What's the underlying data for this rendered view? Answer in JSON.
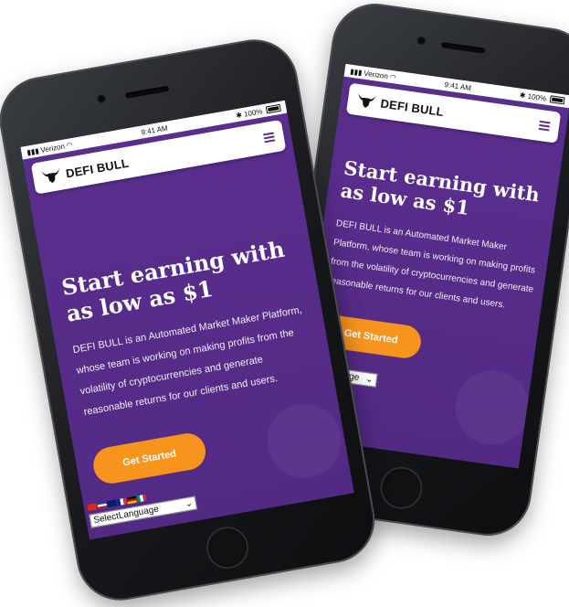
{
  "phones": {
    "left": {
      "status": {
        "carrier": "Verizon",
        "time": "9:41 AM",
        "battery": "100%"
      },
      "brand": "DEFI BULL",
      "hero": {
        "title": "Start earning with as low as $1",
        "text": "DEFI BULL is an Automated Market Maker Platform, whose team is working on making profits from the volatility of cryptocurrencies and generate reasonable returns for our clients and users."
      },
      "cta": "Get Started",
      "language_select": "SelectLanguage"
    },
    "right": {
      "status": {
        "carrier": "Verizon",
        "time": "9:41 AM",
        "battery": "100%"
      },
      "brand": "DEFI BULL",
      "hero": {
        "title": "Start earning with as low as $1",
        "text": "DEFI BULL is an Automated Market Maker Platform, whose team is working on making profits from the volatility of cryptocurrencies and generate reasonable returns for our clients and users."
      },
      "cta": "Get Started",
      "language_select": "Language"
    }
  },
  "icons": [
    "bull-logo-icon",
    "hamburger-menu-icon",
    "signal-icon",
    "wifi-icon",
    "battery-icon",
    "flag-icons",
    "dropdown-arrow-icon"
  ],
  "colors": {
    "screen": "#5b2e8e",
    "cta": "#f7941d",
    "nav": "#ffffff"
  }
}
